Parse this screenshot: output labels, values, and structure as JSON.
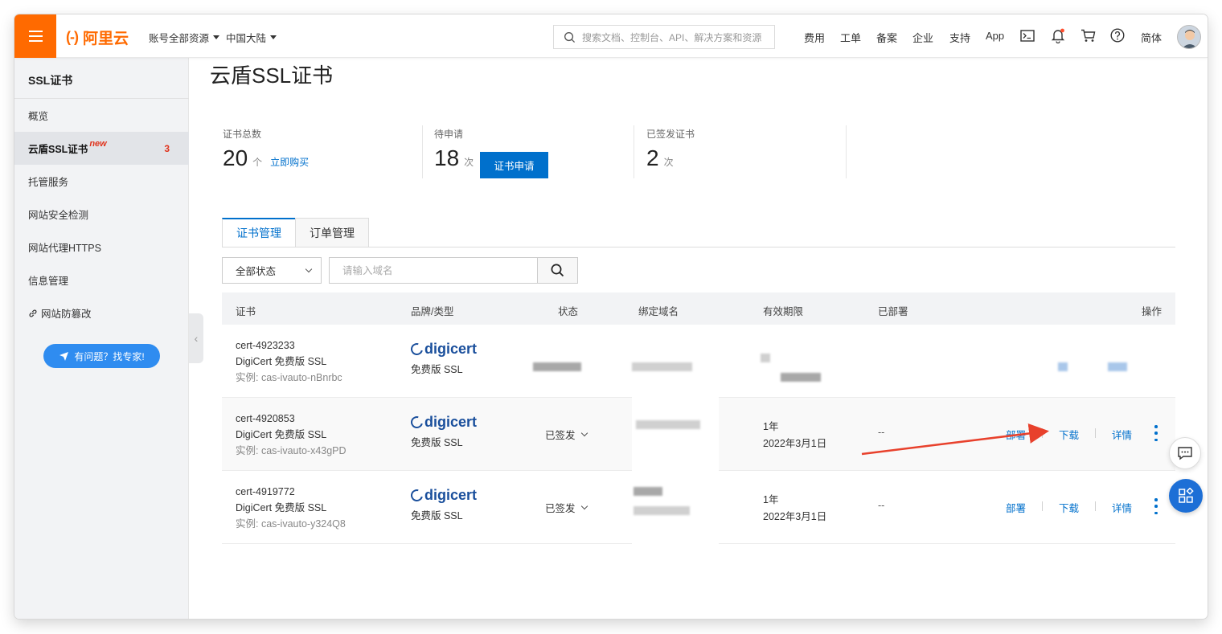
{
  "header": {
    "logo_text": "阿里云",
    "logo_mark": "(-)",
    "account_scope": "账号全部资源",
    "region": "中国大陆",
    "search_placeholder": "搜索文档、控制台、API、解决方案和资源",
    "nav": [
      "费用",
      "工单",
      "备案",
      "企业",
      "支持",
      "App"
    ],
    "lang": "简体",
    "brand_color": "#ff6a00"
  },
  "sidebar": {
    "title": "SSL证书",
    "items": [
      {
        "label": "概览"
      },
      {
        "label": "云盾SSL证书",
        "tag": "new",
        "count": "3",
        "active": true
      },
      {
        "label": "托管服务"
      },
      {
        "label": "网站安全检测"
      },
      {
        "label": "网站代理HTTPS"
      },
      {
        "label": "信息管理"
      },
      {
        "label": "网站防篡改",
        "icon": "link-icon"
      }
    ],
    "help_button": "有问题？找专家!"
  },
  "main": {
    "page_title": "云盾SSL证书",
    "stats": [
      {
        "label": "证书总数",
        "value": "20",
        "unit": "个",
        "link": "立即购买"
      },
      {
        "label": "待申请",
        "value": "18",
        "unit": "次",
        "button": "证书申请"
      },
      {
        "label": "已签发证书",
        "value": "2",
        "unit": "次"
      }
    ],
    "tabs": [
      {
        "label": "证书管理",
        "active": true
      },
      {
        "label": "订单管理"
      }
    ],
    "filter": {
      "status_value": "全部状态",
      "domain_placeholder": "请输入域名"
    },
    "table": {
      "headers": [
        "证书",
        "品牌/类型",
        "状态",
        "绑定域名",
        "有效期限",
        "已部署",
        "操作"
      ],
      "rows": [
        {
          "cert_id": "cert-4923233",
          "cert_name": "DigiCert 免费版 SSL",
          "instance": "实例: cas-ivauto-nBnrbc",
          "brand": "digicert",
          "brand_type": "免费版 SSL",
          "status": "",
          "validity_term": "",
          "validity_date": "",
          "deployed": "",
          "actions": []
        },
        {
          "cert_id": "cert-4920853",
          "cert_name": "DigiCert 免费版 SSL",
          "instance": "实例: cas-ivauto-x43gPD",
          "brand": "digicert",
          "brand_type": "免费版 SSL",
          "status": "已签发",
          "validity_term": "1年",
          "validity_date": "2022年3月1日",
          "deployed": "--",
          "actions": [
            "部署",
            "下载",
            "详情"
          ]
        },
        {
          "cert_id": "cert-4919772",
          "cert_name": "DigiCert 免费版 SSL",
          "instance": "实例: cas-ivauto-y324Q8",
          "brand": "digicert",
          "brand_type": "免费版 SSL",
          "status": "已签发",
          "validity_term": "1年",
          "validity_date": "2022年3月1日",
          "deployed": "--",
          "actions": [
            "部署",
            "下载",
            "详情"
          ]
        }
      ]
    }
  },
  "colors": {
    "primary": "#0070cc",
    "accent": "#ff6a00",
    "annotation_arrow": "#e8412c"
  }
}
